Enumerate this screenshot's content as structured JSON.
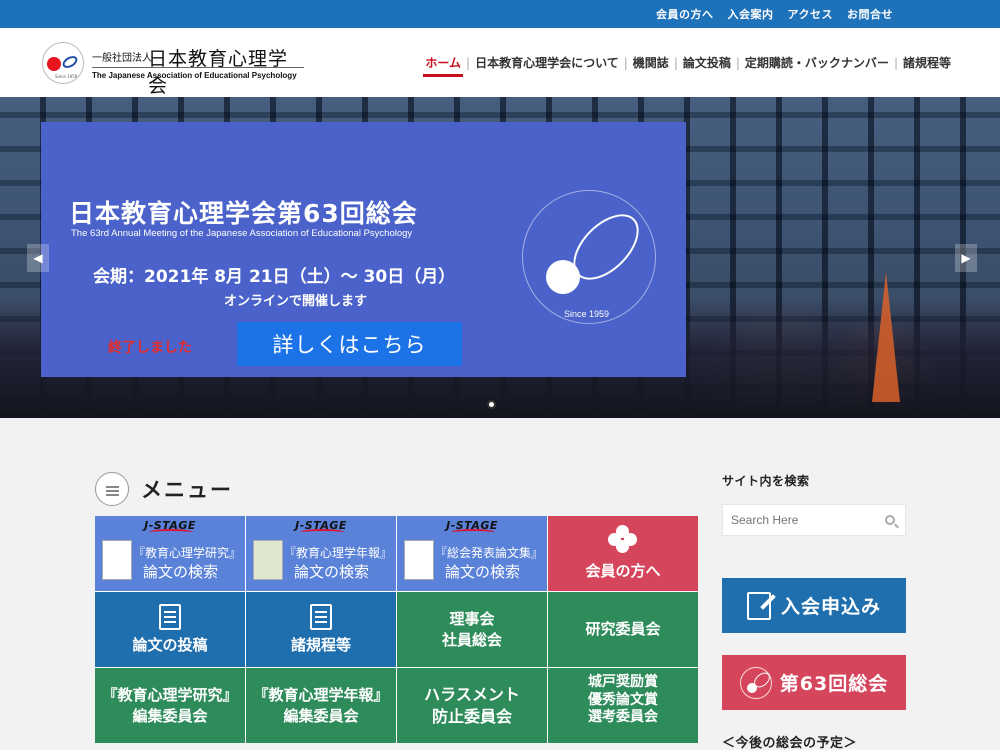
{
  "topbar": {
    "links": [
      "会員の方へ",
      "入会案内",
      "アクセス",
      "お問合せ"
    ]
  },
  "header": {
    "logo_small": "一般社団法人",
    "logo_main": "日本教育心理学会",
    "logo_en": "The Japanese Association of Educational Psychology"
  },
  "nav": {
    "items": [
      "ホーム",
      "日本教育心理学会について",
      "機関誌",
      "論文投稿",
      "定期購読・バックナンバー",
      "諸規程等"
    ],
    "active_index": 0
  },
  "hero": {
    "title": "日本教育心理学会第63回総会",
    "subtitle": "The 63rd Annual Meeting of the Japanese Association of Educational Psychology",
    "dates": "会期：2021年 8月 21日（土）～ 30日（月）",
    "online": "オンラインで開催します",
    "ended": "終了しました",
    "cta": "詳しくはこちら",
    "emblem_text": "The Japanese Association of Educational Psychology",
    "since": "Since 1959",
    "slide_count": 1,
    "colors": {
      "banner": "#4a62c9",
      "cta": "#1c73e8",
      "ended": "#e22b2b"
    }
  },
  "menu": {
    "title": "メニュー",
    "jstage_label": "J-STAGE",
    "tiles": [
      {
        "type": "jstage",
        "caption": "『教育心理学研究』",
        "main": "論文の検索"
      },
      {
        "type": "jstage",
        "caption": "『教育心理学年報』",
        "main": "論文の検索"
      },
      {
        "type": "jstage",
        "caption": "『総会発表論文集』",
        "main": "論文の検索"
      },
      {
        "type": "red",
        "icon": "clover-icon",
        "label": "会員の方へ"
      },
      {
        "type": "blue",
        "icon": "edit-icon",
        "label": "論文の投稿"
      },
      {
        "type": "blue",
        "icon": "document-icon",
        "label": "諸規程等"
      },
      {
        "type": "green",
        "line1": "理事会",
        "line2": "社員総会"
      },
      {
        "type": "green",
        "line1": "研究委員会"
      },
      {
        "type": "green",
        "line1": "『教育心理学研究』",
        "line2": "編集委員会"
      },
      {
        "type": "green",
        "line1": "『教育心理学年報』",
        "line2": "編集委員会"
      },
      {
        "type": "green",
        "line1": "ハラスメント",
        "line2": "防止委員会"
      },
      {
        "type": "green",
        "line1": "城戸奨励賞",
        "line2": "優秀論文賞",
        "line3": "選考委員会"
      }
    ]
  },
  "sidebar": {
    "search_title": "サイト内を検索",
    "search_placeholder": "Search Here",
    "join_label": "入会申込み",
    "meeting_label": "第63回総会",
    "schedule_title": "＜今後の総会の予定＞"
  },
  "colors": {
    "topbar": "#1e72b9",
    "nav_active": "#c8101e",
    "tile_jstage": "#5b82d9",
    "tile_red": "#d5455b",
    "tile_blue": "#1f6fae",
    "tile_green": "#2e8b5a"
  }
}
